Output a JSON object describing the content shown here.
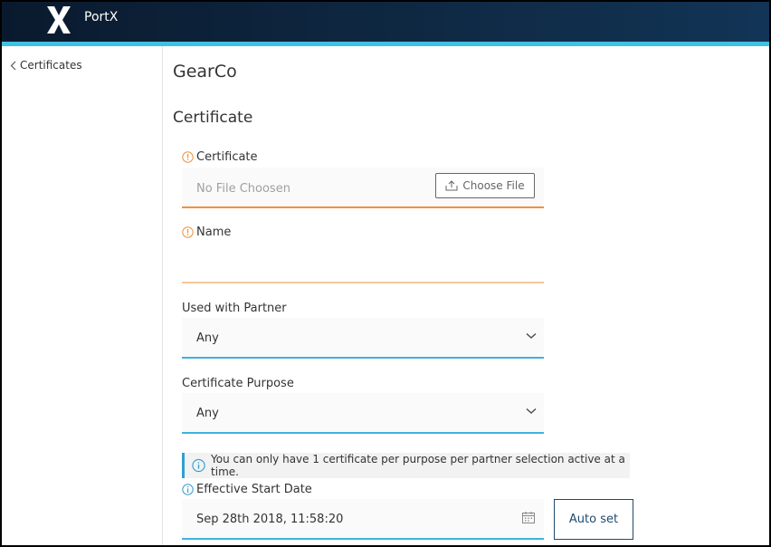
{
  "app": {
    "brand": "PortX"
  },
  "sidebar": {
    "back_label": "Certificates"
  },
  "page": {
    "company": "GearCo",
    "section_title": "Certificate"
  },
  "form": {
    "certificate": {
      "label": "Certificate",
      "placeholder": "No File Choosen",
      "button_label": "Choose File"
    },
    "name": {
      "label": "Name",
      "value": ""
    },
    "partner": {
      "label": "Used with Partner",
      "value": "Any"
    },
    "purpose": {
      "label": "Certificate Purpose",
      "value": "Any"
    },
    "info_message": "You can only have 1 certificate per purpose per partner selection active at a time.",
    "start_date": {
      "label": "Effective Start Date",
      "value": "Sep 28th 2018, 11:58:20",
      "button_label": "Auto set"
    }
  },
  "colors": {
    "header_bg": "#0f2a45",
    "accent": "#3fc1e3",
    "required": "#f0913a",
    "info": "#2f9ed0",
    "button_text": "#1e4a6e"
  }
}
